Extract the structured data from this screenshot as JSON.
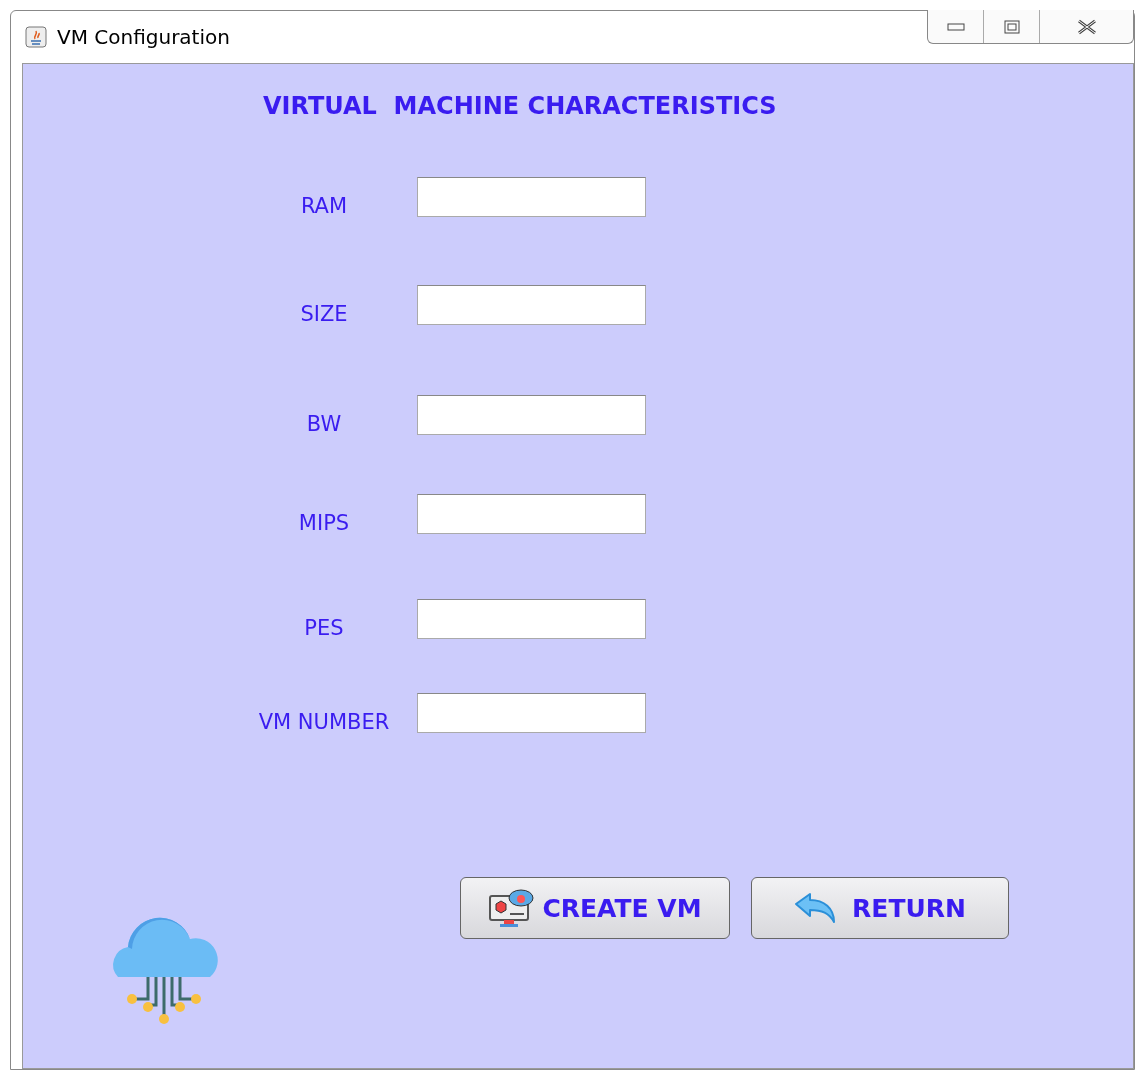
{
  "window": {
    "title": "VM Configuration"
  },
  "heading": "VIRTUAL  MACHINE CHARACTERISTICS",
  "fields": [
    {
      "label": "RAM"
    },
    {
      "label": "SIZE"
    },
    {
      "label": "BW"
    },
    {
      "label": "MIPS"
    },
    {
      "label": "PES"
    },
    {
      "label": "VM NUMBER"
    }
  ],
  "buttons": [
    {
      "label": "CREATE VM",
      "kind": "create"
    },
    {
      "label": "RETURN",
      "kind": "return"
    }
  ]
}
